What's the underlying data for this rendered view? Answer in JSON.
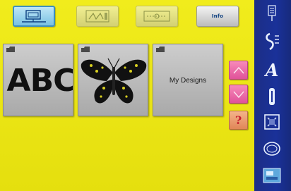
{
  "tabs": [
    {
      "icon": "embroidery-hoop-icon",
      "state": "active"
    },
    {
      "icon": "stitch-pattern-icon",
      "state": "inactive"
    },
    {
      "icon": "editing-icon",
      "state": "inactive"
    },
    {
      "label": "Info",
      "state": "inactive"
    }
  ],
  "tiles": [
    {
      "text": "ABC",
      "icon": "alphabet-design"
    },
    {
      "icon": "butterfly-design"
    },
    {
      "text": "My Designs"
    }
  ],
  "side_buttons": [
    {
      "icon": "scroll-up-icon"
    },
    {
      "icon": "scroll-down-icon"
    },
    {
      "icon": "help-icon",
      "text": "?"
    }
  ],
  "sidebar": {
    "items": [
      {
        "icon": "needle-icon"
      },
      {
        "icon": "stitch-icon"
      },
      {
        "icon": "alphabet-icon",
        "text": "A"
      },
      {
        "icon": "buttonhole-icon"
      },
      {
        "icon": "quilt-icon"
      },
      {
        "icon": "embroidery-icon"
      },
      {
        "icon": "setup-icon"
      }
    ]
  },
  "colors": {
    "background": "#e9e412",
    "sidebar": "#1a3199",
    "active_tab": "#79c1e3",
    "pink_button": "#e0529a",
    "help_button": "#e08658"
  }
}
